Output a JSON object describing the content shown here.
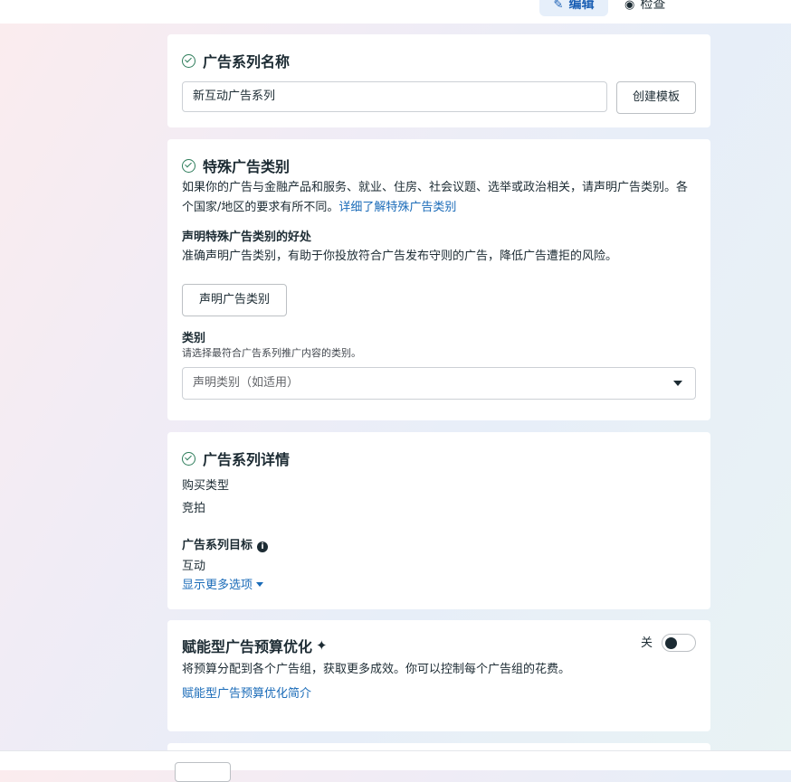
{
  "header": {
    "tab_edit": "编辑",
    "tab_review": "检查"
  },
  "campaign_name": {
    "title": "广告系列名称",
    "input_value": "新互动广告系列",
    "template_button": "创建模板"
  },
  "special_category": {
    "title": "特殊广告类别",
    "description": "如果你的广告与金融产品和服务、就业、住房、社会议题、选举或政治相关，请声明广告类别。各个国家/地区的要求有所不同。",
    "learn_more": "详细了解特殊广告类别",
    "benefit_title": "声明特殊广告类别的好处",
    "benefit_text": "准确声明广告类别，有助于你投放符合广告发布守则的广告，降低广告遭拒的风险。",
    "declare_button": "声明广告类别",
    "category_label": "类别",
    "category_hint": "请选择最符合广告系列推广内容的类别。",
    "category_placeholder": "声明类别（如适用）"
  },
  "campaign_details": {
    "title": "广告系列详情",
    "buying_type_label": "购买类型",
    "buying_type_value": "竞拍",
    "objective_label": "广告系列目标",
    "objective_value": "互动",
    "more_options": "显示更多选项"
  },
  "budget_optimization": {
    "title": "赋能型广告预算优化",
    "toggle_label": "关",
    "toggle_on": false,
    "description": "将预算分配到各个广告组，获取更多成效。你可以控制每个广告组的花费。",
    "intro_link": "赋能型广告预算优化简介"
  }
}
